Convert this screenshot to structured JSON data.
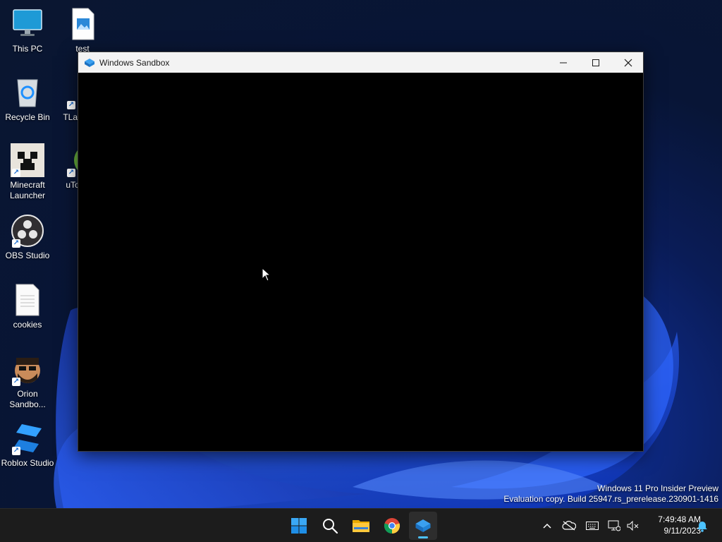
{
  "desktop": {
    "icons": [
      {
        "label": "This PC",
        "icon": "monitor-icon"
      },
      {
        "label": "test",
        "icon": "image-file-icon"
      },
      {
        "label": "Recycle Bin",
        "icon": "recycle-bin-icon"
      },
      {
        "label": "TLau",
        "icon": "tlauncher-icon"
      },
      {
        "label": "Minecraft\nLauncher",
        "icon": "minecraft-icon"
      },
      {
        "label": "uTorr",
        "icon": "utorrent-icon"
      },
      {
        "label": "OBS Studio",
        "icon": "obs-icon"
      },
      {
        "label": "cookies",
        "icon": "text-file-icon"
      },
      {
        "label": "Orion\nSandbo...",
        "icon": "orion-sandbox-icon"
      },
      {
        "label": "Roblox Studio",
        "icon": "roblox-studio-icon"
      }
    ]
  },
  "window": {
    "title": "Windows Sandbox",
    "controls": [
      "minimize",
      "maximize",
      "close"
    ]
  },
  "watermark": {
    "line1": "Windows 11 Pro Insider Preview",
    "line2": "Evaluation copy. Build 25947.rs_prerelease.230901-1416"
  },
  "taskbar": {
    "apps": [
      {
        "name": "start",
        "icon": "windows-logo-icon"
      },
      {
        "name": "search",
        "icon": "search-icon"
      },
      {
        "name": "file-explorer",
        "icon": "folder-icon"
      },
      {
        "name": "chrome",
        "icon": "chrome-icon"
      },
      {
        "name": "windows-sandbox",
        "icon": "sandbox-icon",
        "active": true
      }
    ],
    "tray": [
      "chevron-up-icon",
      "cloud-off-icon",
      "keyboard-icon",
      "network-icon",
      "volume-muted-icon"
    ],
    "clock": {
      "time": "7:49:48 AM",
      "date": "9/11/2023"
    }
  },
  "colors": {
    "accent": "#4cc2ff",
    "taskbar_bg": "#1c1c1c",
    "titlebar_bg": "#f3f3f3"
  }
}
